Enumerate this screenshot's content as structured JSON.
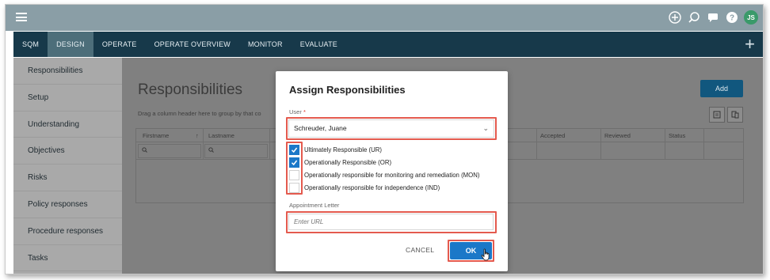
{
  "topbar": {
    "avatar_initials": "JS",
    "icons": [
      "menu-icon",
      "add-circle-icon",
      "search-icon",
      "chat-icon",
      "help-icon"
    ]
  },
  "nav": {
    "tabs": [
      "SQM",
      "DESIGN",
      "OPERATE",
      "OPERATE OVERVIEW",
      "MONITOR",
      "EVALUATE"
    ],
    "active": "DESIGN"
  },
  "sidebar": {
    "items": [
      "Responsibilities",
      "Setup",
      "Understanding",
      "Objectives",
      "Risks",
      "Policy responses",
      "Procedure responses",
      "Tasks"
    ]
  },
  "page": {
    "title": "Responsibilities",
    "group_hint": "Drag a column header here to group by that co",
    "add_label": "Add",
    "columns": [
      "Firstname",
      "Lastname",
      "Accepted",
      "Reviewed",
      "Status"
    ]
  },
  "modal": {
    "title": "Assign Responsibilities",
    "user_label": "User",
    "required_mark": "*",
    "user_value": "Schreuder, Juane",
    "checkboxes": [
      {
        "label": "Ultimately Responsible (UR)",
        "checked": true
      },
      {
        "label": "Operationally Responsible (OR)",
        "checked": true
      },
      {
        "label": "Operationally responsible for monitoring and remediation (MON)",
        "checked": false
      },
      {
        "label": "Operationally responsible for independence (IND)",
        "checked": false
      }
    ],
    "appointment_label": "Appointment Letter",
    "url_placeholder": "Enter URL",
    "cancel_label": "CANCEL",
    "ok_label": "OK"
  },
  "colors": {
    "nav_bg": "#17394a",
    "primary": "#1b78c8",
    "highlight": "#e45a4e"
  }
}
